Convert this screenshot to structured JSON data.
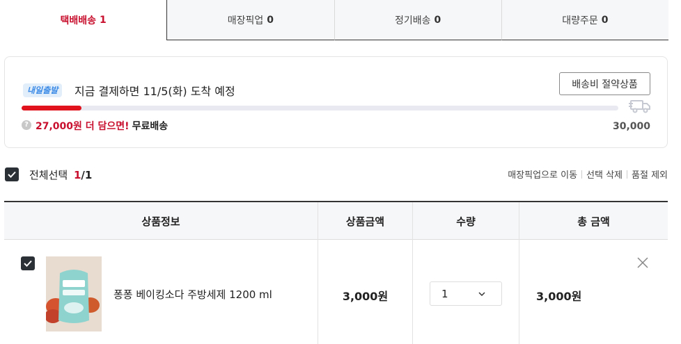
{
  "tabs": [
    {
      "label": "택배배송",
      "count": "1",
      "active": true
    },
    {
      "label": "매장픽업",
      "count": "0",
      "active": false
    },
    {
      "label": "정기배송",
      "count": "0",
      "active": false
    },
    {
      "label": "대량주문",
      "count": "0",
      "active": false
    }
  ],
  "delivery": {
    "badge": "내일출발",
    "eta_text": "지금 결제하면 11/5(화) 도착 예정",
    "saver_button": "배송비 절약상품",
    "progress_fraction": 0.1,
    "remain_text": "27,000원 더 담으면!",
    "free_label": "무료배송",
    "threshold": "30,000",
    "help_symbol": "?"
  },
  "select": {
    "label": "전체선택",
    "current": "1",
    "total": "/1",
    "actions": [
      "매장픽업으로 이동",
      "선택 삭제",
      "품절 제외"
    ]
  },
  "table": {
    "headers": [
      "상품정보",
      "상품금액",
      "수량",
      "총 금액"
    ],
    "items": [
      {
        "name": "퐁퐁 베이킹소다 주방세제 1200 ml",
        "price": "3,000원",
        "qty": "1",
        "total": "3,000원"
      }
    ]
  },
  "colors": {
    "accent": "#c8102e",
    "progress": "#e1141e",
    "badge_text": "#3b8be6",
    "dark": "#2b2f36"
  }
}
